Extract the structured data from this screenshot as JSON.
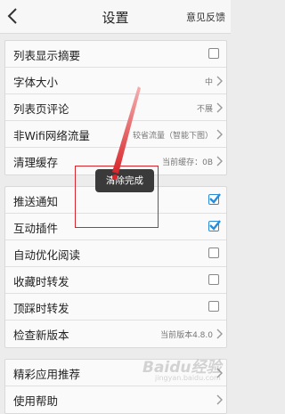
{
  "header": {
    "title": "设置",
    "feedback": "意见反馈"
  },
  "group1": [
    {
      "label": "列表显示摘要",
      "control": "checkbox",
      "checked": false
    },
    {
      "label": "字体大小",
      "value": "中",
      "control": "chevron"
    },
    {
      "label": "列表页评论",
      "value": "不展",
      "control": "chevron"
    },
    {
      "label": "非Wifi网络流量",
      "value": "较省流量（智能下图）",
      "control": "chevron"
    },
    {
      "label": "清理缓存",
      "value": "当前缓存：0B",
      "control": "chevron"
    }
  ],
  "group2": [
    {
      "label": "推送通知",
      "control": "checkbox",
      "checked": true
    },
    {
      "label": "互动插件",
      "control": "checkbox",
      "checked": true
    },
    {
      "label": "自动优化阅读",
      "control": "checkbox",
      "checked": false
    },
    {
      "label": "收藏时转发",
      "control": "checkbox",
      "checked": false
    },
    {
      "label": "顶踩时转发",
      "control": "checkbox",
      "checked": false
    },
    {
      "label": "检查新版本",
      "value": "当前版本4.8.0",
      "control": "chevron"
    }
  ],
  "group3": [
    {
      "label": "精彩应用推荐",
      "control": "chevron"
    },
    {
      "label": "使用帮助",
      "control": "chevron"
    }
  ],
  "toast": "清除完成",
  "watermark": {
    "text": "Baidu经验",
    "sub": "jingyan.baidu.com"
  },
  "colors": {
    "checkbox_checked": "#2a8bd6",
    "highlight": "#d8252a"
  }
}
